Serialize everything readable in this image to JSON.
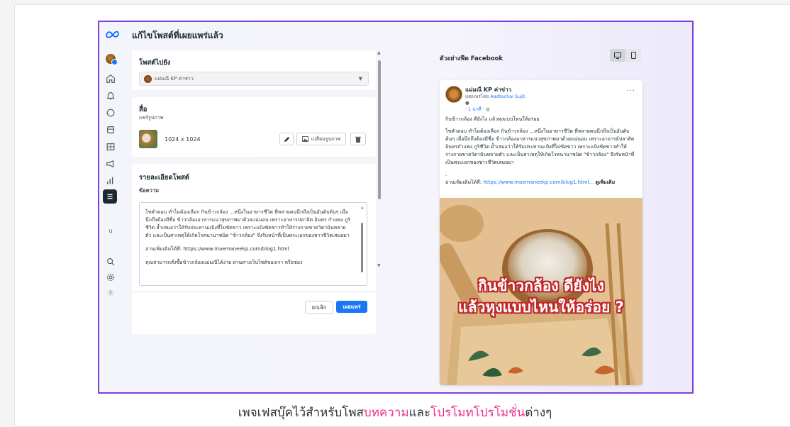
{
  "page_title": "แก้ไขโพสต์ที่เผยแพร่แล้ว",
  "sidebar": {
    "icons": [
      "avatar",
      "home-icon",
      "bell-icon",
      "chat-icon",
      "folder-icon",
      "table-icon",
      "megaphone-icon",
      "insights-icon",
      "menu-icon"
    ],
    "text_item": "u"
  },
  "post_to": {
    "title": "โพสต์ไปยัง",
    "page_name": "แม่มณี KP ค่าข่าว"
  },
  "media": {
    "title": "สื่อ",
    "subtitle": "แชร์รูปภาพ",
    "dimensions": "1024 x 1024",
    "replace_label": "เปลี่ยนรูปภาพ"
  },
  "details": {
    "title": "รายละเอียดโพสต์",
    "text_label": "ข้อความ",
    "paragraphs": [
      "ไขคำตอบ ทำไมต้องเลือก กินข้าวกล้อง ...หนึ่งในอาหารชีวิต ที่หลายคนนึกถึงเป็นอันดับต้นๆ เมื่อนึกถึงต้องมีชื่อ ข้าวกล้องอาหารแนวสุขภาพมาด้วยแน่นอน เพราะอาหารปลาสิต อินทร กำแพง ภูริชีวิต ย้ำเสมอว่าให้รับประทานแป้งที่ไม่ขัดขาว เพราะแป้งขัดขาวทำให้ร่างกายขาดวิตามินหลายตัว และเป็นสาเหตุให้เกิดโรคนานาชนิด \"ข้าวกล้อง\" จึงรับหน้าที่เป็นพระเอกของชาวชีวิตเสมอมา",
      "อ่านเพิ่มเติมได้ที่: https://www.maemaneekp.com/blog1.html",
      "คุณสามารถสั่งซื้อข้าวกล้องแม่มณีได้ง่าย ผ่านทางเว็บไซต์ของเรา หรือช่อง"
    ]
  },
  "buttons": {
    "cancel": "ยกเลิก",
    "publish": "เผยแพร่"
  },
  "preview": {
    "label": "ตัวอย่างฟีด Facebook",
    "page_name": "แม่มณี KP ค่าข่าว",
    "published_by": "เผยแพร่โดย",
    "author": "Aadtachai Sujit",
    "time": "· 1 นาที · ",
    "headline": "กินข้าวกล้อง ดียังไง แล้วหุงแบบไหนให้อร่อย",
    "body": "ไขคำตอบ ทำไมต้องเลือก กินข้าวกล้อง ...หนึ่งในอาหารชีวิต ที่หลายคนนึกถึงเป็นอันดับต้นๆ เมื่อนึกถึงต้องมีชื่อ ข้าวกล้องอาหารแนวสุขภาพมาด้วยแน่นอน เพราะอาจารย์ปลาสิต อินทรกำแพง ภูริชีวิต ย้ำเสมอว่าให้รับประทานแป้งที่ไม่ขัดขาว เพราะแป้งขัดขาวทำให้ร่างกายขาดวิตามินหลายตัว และเป็นสาเหตุให้เกิดโรคนานาชนิด \"ข้าวกล้อง\" จึงรับหน้าที่เป็นพระเอกของชาวชีวิตเสมอมา",
    "dot": ".",
    "read_more_prefix": "อ่านเพิ่มเติมได้ที่: ",
    "read_more_link": "https://www.maemaneekp.com/blog1.html...",
    "see_more": "ดูเพิ่มเติม",
    "image_line1": "กินข้าวกล้อง ดียังไง",
    "image_line2": "แล้วหุงแบบไหนให้อร่อย ?"
  },
  "caption": {
    "part1": "เพจเฟสบุ๊คไว้สำหรับโพส",
    "part2": "บทความ",
    "part3": "และ",
    "part4": "โปรโมทโปรโมชั่น",
    "part5": "ต่างๆ"
  },
  "colors": {
    "frame": "#7b3fe0",
    "accent": "#1877f2",
    "caption_highlight": "#e8348c",
    "headline_stroke": "#c0282b"
  }
}
